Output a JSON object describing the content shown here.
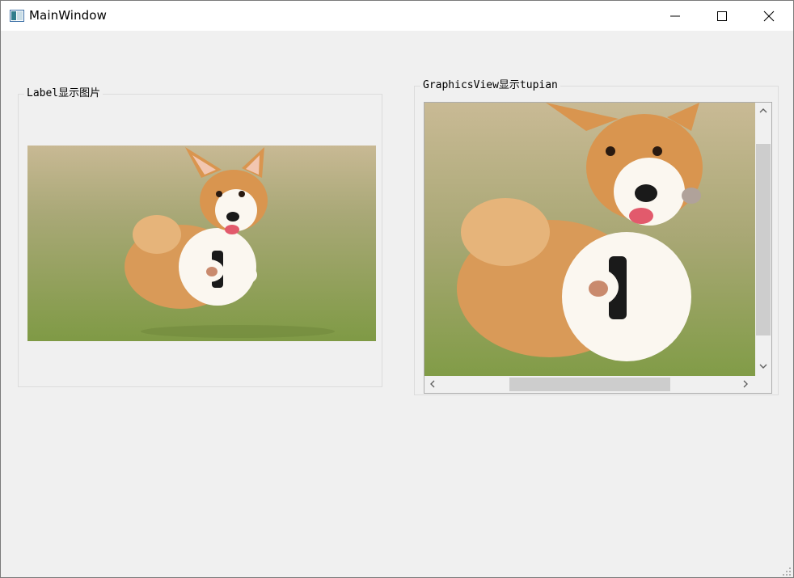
{
  "window": {
    "title": "MainWindow",
    "icon": "app-window-icon",
    "controls": [
      "minimize-icon",
      "maximize-icon",
      "close-icon"
    ]
  },
  "label_group": {
    "title": "Label显示图片",
    "image": "corgi-photo"
  },
  "graphics_group": {
    "title": "GraphicsView显示tupian",
    "image": "corgi-photo-zoomed",
    "vertical_scroll_icons": [
      "chevron-up-icon",
      "chevron-down-icon"
    ],
    "horizontal_scroll_icons": [
      "chevron-left-icon",
      "chevron-right-icon"
    ]
  },
  "colors": {
    "window_bg": "#f0f0f0",
    "titlebar_bg": "#ffffff",
    "group_border": "#dcdcdc",
    "scroll_thumb": "#cdcdcd",
    "grass": "#8aa052",
    "fur_orange": "#d99a58",
    "fur_white": "#fbf7f0"
  }
}
